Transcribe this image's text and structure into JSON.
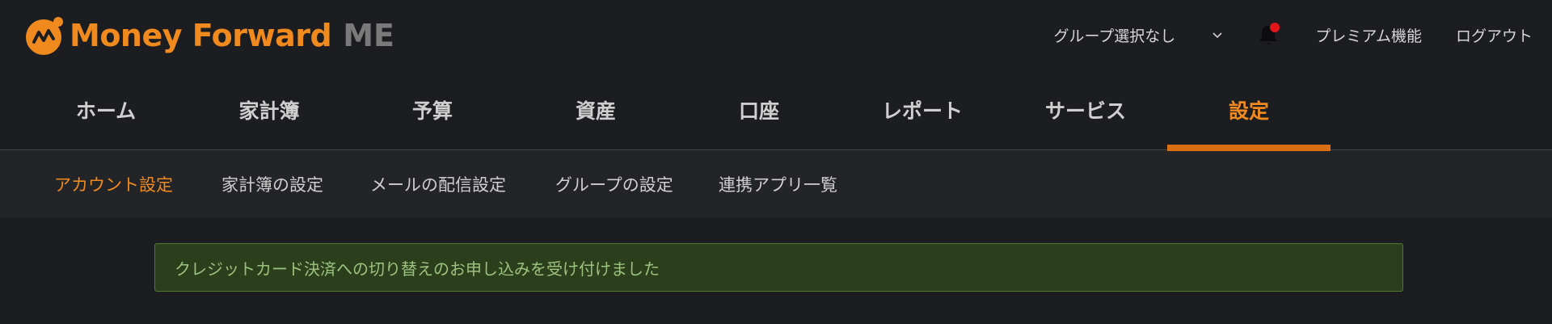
{
  "header": {
    "brand": "Money Forward",
    "brand_suffix": "ME",
    "group_select_value": "グループ選択なし",
    "premium_label": "プレミアム機能",
    "logout_label": "ログアウト"
  },
  "main_nav": {
    "items": [
      {
        "label": "ホーム"
      },
      {
        "label": "家計簿"
      },
      {
        "label": "予算"
      },
      {
        "label": "資産"
      },
      {
        "label": "口座"
      },
      {
        "label": "レポート"
      },
      {
        "label": "サービス"
      },
      {
        "label": "設定"
      }
    ],
    "active": "設定"
  },
  "sub_nav": {
    "items": [
      {
        "label": "アカウント設定"
      },
      {
        "label": "家計簿の設定"
      },
      {
        "label": "メールの配信設定"
      },
      {
        "label": "グループの設定"
      },
      {
        "label": "連携アプリ一覧"
      }
    ],
    "active": "アカウント設定"
  },
  "alert": {
    "message": "クレジットカード決済への切り替えのお申し込みを受け付けました"
  },
  "colors": {
    "accent": "#f08a1f",
    "background": "#1c1d20",
    "subnav_bg": "#232428",
    "alert_bg": "#2b3f1c",
    "alert_text": "#9cc27f",
    "notification_dot": "#e0161b"
  },
  "icons": {
    "logo": "money-forward-logo-icon",
    "group_dropdown": "chevron-down-icon",
    "notifications": "bell-icon"
  }
}
